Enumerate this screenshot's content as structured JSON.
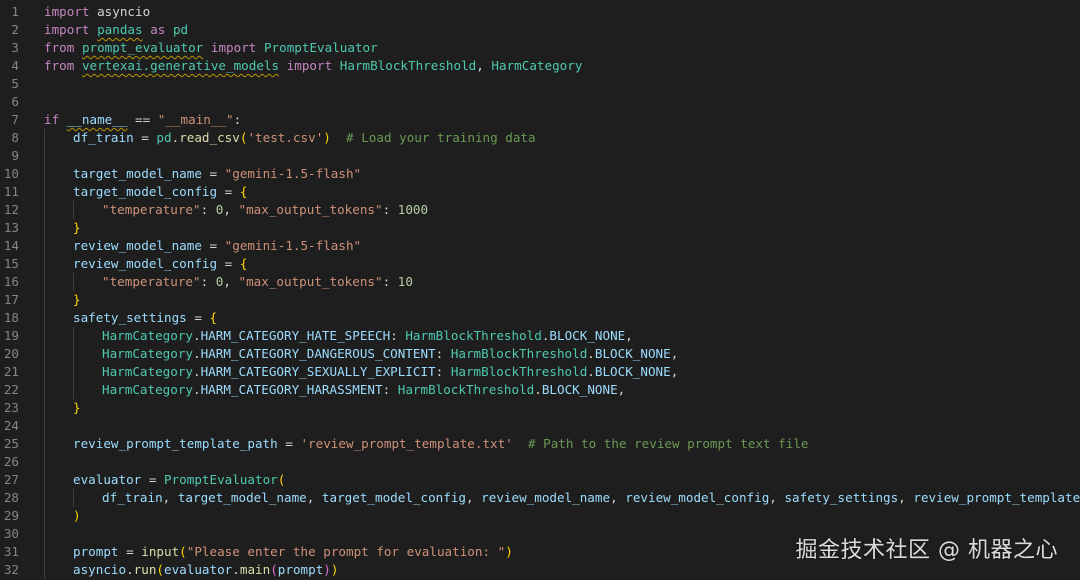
{
  "editor": {
    "language": "python",
    "lines": [
      {
        "n": "1",
        "indent": 0,
        "tokens": [
          [
            "kw",
            "import"
          ],
          [
            "pl",
            " "
          ],
          [
            "pl",
            "asyncio"
          ]
        ]
      },
      {
        "n": "2",
        "indent": 0,
        "tokens": [
          [
            "kw",
            "import"
          ],
          [
            "pl",
            " "
          ],
          [
            "cls sq",
            "pandas"
          ],
          [
            "pl",
            " "
          ],
          [
            "kw",
            "as"
          ],
          [
            "pl",
            " "
          ],
          [
            "cls",
            "pd"
          ]
        ]
      },
      {
        "n": "3",
        "indent": 0,
        "tokens": [
          [
            "kw",
            "from"
          ],
          [
            "pl",
            " "
          ],
          [
            "cls sq",
            "prompt_evaluator"
          ],
          [
            "pl",
            " "
          ],
          [
            "kw",
            "import"
          ],
          [
            "pl",
            " "
          ],
          [
            "cls",
            "PromptEvaluator"
          ]
        ]
      },
      {
        "n": "4",
        "indent": 0,
        "tokens": [
          [
            "kw",
            "from"
          ],
          [
            "pl",
            " "
          ],
          [
            "cls sq",
            "vertexai.generative_models"
          ],
          [
            "pl",
            " "
          ],
          [
            "kw",
            "import"
          ],
          [
            "pl",
            " "
          ],
          [
            "cls",
            "HarmBlockThreshold"
          ],
          [
            "pl",
            ", "
          ],
          [
            "cls",
            "HarmCategory"
          ]
        ]
      },
      {
        "n": "5",
        "indent": 0,
        "tokens": []
      },
      {
        "n": "6",
        "indent": 0,
        "tokens": []
      },
      {
        "n": "7",
        "indent": 0,
        "tokens": [
          [
            "kw",
            "if"
          ],
          [
            "pl",
            " "
          ],
          [
            "var sq",
            "__name__"
          ],
          [
            "pl",
            " == "
          ],
          [
            "str",
            "\"__main__\""
          ],
          [
            "pl",
            ":"
          ]
        ]
      },
      {
        "n": "8",
        "indent": 1,
        "tokens": [
          [
            "var",
            "df_train"
          ],
          [
            "pl",
            " = "
          ],
          [
            "cls",
            "pd"
          ],
          [
            "pl",
            "."
          ],
          [
            "fn",
            "read_csv"
          ],
          [
            "br1",
            "("
          ],
          [
            "str",
            "'test.csv'"
          ],
          [
            "br1",
            ")"
          ],
          [
            "pl",
            "  "
          ],
          [
            "cmt",
            "# Load your training data"
          ]
        ]
      },
      {
        "n": "9",
        "indent": 1,
        "tokens": []
      },
      {
        "n": "10",
        "indent": 1,
        "tokens": [
          [
            "var",
            "target_model_name"
          ],
          [
            "pl",
            " = "
          ],
          [
            "str",
            "\"gemini-1.5-flash\""
          ]
        ]
      },
      {
        "n": "11",
        "indent": 1,
        "tokens": [
          [
            "var",
            "target_model_config"
          ],
          [
            "pl",
            " = "
          ],
          [
            "br1",
            "{"
          ]
        ]
      },
      {
        "n": "12",
        "indent": 2,
        "tokens": [
          [
            "str",
            "\"temperature\""
          ],
          [
            "pl",
            ": "
          ],
          [
            "num",
            "0"
          ],
          [
            "pl",
            ", "
          ],
          [
            "str",
            "\"max_output_tokens\""
          ],
          [
            "pl",
            ": "
          ],
          [
            "num",
            "1000"
          ]
        ]
      },
      {
        "n": "13",
        "indent": 1,
        "tokens": [
          [
            "br1",
            "}"
          ]
        ]
      },
      {
        "n": "14",
        "indent": 1,
        "tokens": [
          [
            "var",
            "review_model_name"
          ],
          [
            "pl",
            " = "
          ],
          [
            "str",
            "\"gemini-1.5-flash\""
          ]
        ]
      },
      {
        "n": "15",
        "indent": 1,
        "tokens": [
          [
            "var",
            "review_model_config"
          ],
          [
            "pl",
            " = "
          ],
          [
            "br1",
            "{"
          ]
        ]
      },
      {
        "n": "16",
        "indent": 2,
        "tokens": [
          [
            "str",
            "\"temperature\""
          ],
          [
            "pl",
            ": "
          ],
          [
            "num",
            "0"
          ],
          [
            "pl",
            ", "
          ],
          [
            "str",
            "\"max_output_tokens\""
          ],
          [
            "pl",
            ": "
          ],
          [
            "num",
            "10"
          ]
        ]
      },
      {
        "n": "17",
        "indent": 1,
        "tokens": [
          [
            "br1",
            "}"
          ]
        ]
      },
      {
        "n": "18",
        "indent": 1,
        "tokens": [
          [
            "var",
            "safety_settings"
          ],
          [
            "pl",
            " = "
          ],
          [
            "br1",
            "{"
          ]
        ]
      },
      {
        "n": "19",
        "indent": 2,
        "tokens": [
          [
            "cls",
            "HarmCategory"
          ],
          [
            "pl",
            "."
          ],
          [
            "var",
            "HARM_CATEGORY_HATE_SPEECH"
          ],
          [
            "pl",
            ": "
          ],
          [
            "cls",
            "HarmBlockThreshold"
          ],
          [
            "pl",
            "."
          ],
          [
            "var",
            "BLOCK_NONE"
          ],
          [
            "pl",
            ","
          ]
        ]
      },
      {
        "n": "20",
        "indent": 2,
        "tokens": [
          [
            "cls",
            "HarmCategory"
          ],
          [
            "pl",
            "."
          ],
          [
            "var",
            "HARM_CATEGORY_DANGEROUS_CONTENT"
          ],
          [
            "pl",
            ": "
          ],
          [
            "cls",
            "HarmBlockThreshold"
          ],
          [
            "pl",
            "."
          ],
          [
            "var",
            "BLOCK_NONE"
          ],
          [
            "pl",
            ","
          ]
        ]
      },
      {
        "n": "21",
        "indent": 2,
        "tokens": [
          [
            "cls",
            "HarmCategory"
          ],
          [
            "pl",
            "."
          ],
          [
            "var",
            "HARM_CATEGORY_SEXUALLY_EXPLICIT"
          ],
          [
            "pl",
            ": "
          ],
          [
            "cls",
            "HarmBlockThreshold"
          ],
          [
            "pl",
            "."
          ],
          [
            "var",
            "BLOCK_NONE"
          ],
          [
            "pl",
            ","
          ]
        ]
      },
      {
        "n": "22",
        "indent": 2,
        "tokens": [
          [
            "cls",
            "HarmCategory"
          ],
          [
            "pl",
            "."
          ],
          [
            "var",
            "HARM_CATEGORY_HARASSMENT"
          ],
          [
            "pl",
            ": "
          ],
          [
            "cls",
            "HarmBlockThreshold"
          ],
          [
            "pl",
            "."
          ],
          [
            "var",
            "BLOCK_NONE"
          ],
          [
            "pl",
            ","
          ]
        ]
      },
      {
        "n": "23",
        "indent": 1,
        "tokens": [
          [
            "br1",
            "}"
          ]
        ]
      },
      {
        "n": "24",
        "indent": 1,
        "tokens": []
      },
      {
        "n": "25",
        "indent": 1,
        "tokens": [
          [
            "var",
            "review_prompt_template_path"
          ],
          [
            "pl",
            " = "
          ],
          [
            "str",
            "'review_prompt_template.txt'"
          ],
          [
            "pl",
            "  "
          ],
          [
            "cmt",
            "# Path to the review prompt text file"
          ]
        ]
      },
      {
        "n": "26",
        "indent": 1,
        "tokens": []
      },
      {
        "n": "27",
        "indent": 1,
        "tokens": [
          [
            "var",
            "evaluator"
          ],
          [
            "pl",
            " = "
          ],
          [
            "cls",
            "PromptEvaluator"
          ],
          [
            "br1",
            "("
          ]
        ]
      },
      {
        "n": "28",
        "indent": 2,
        "tokens": [
          [
            "var",
            "df_train"
          ],
          [
            "pl",
            ", "
          ],
          [
            "var",
            "target_model_name"
          ],
          [
            "pl",
            ", "
          ],
          [
            "var",
            "target_model_config"
          ],
          [
            "pl",
            ", "
          ],
          [
            "var",
            "review_model_name"
          ],
          [
            "pl",
            ", "
          ],
          [
            "var",
            "review_model_config"
          ],
          [
            "pl",
            ", "
          ],
          [
            "var",
            "safety_settings"
          ],
          [
            "pl",
            ", "
          ],
          [
            "var",
            "review_prompt_template_path"
          ]
        ]
      },
      {
        "n": "29",
        "indent": 1,
        "tokens": [
          [
            "br1",
            ")"
          ]
        ]
      },
      {
        "n": "30",
        "indent": 1,
        "tokens": []
      },
      {
        "n": "31",
        "indent": 1,
        "tokens": [
          [
            "var",
            "prompt"
          ],
          [
            "pl",
            " = "
          ],
          [
            "fn",
            "input"
          ],
          [
            "br1",
            "("
          ],
          [
            "str",
            "\"Please enter the prompt for evaluation: \""
          ],
          [
            "br1",
            ")"
          ]
        ]
      },
      {
        "n": "32",
        "indent": 1,
        "tokens": [
          [
            "var",
            "asyncio"
          ],
          [
            "pl",
            "."
          ],
          [
            "fn",
            "run"
          ],
          [
            "br1",
            "("
          ],
          [
            "var",
            "evaluator"
          ],
          [
            "pl",
            "."
          ],
          [
            "fn",
            "main"
          ],
          [
            "br2",
            "("
          ],
          [
            "var",
            "prompt"
          ],
          [
            "br2",
            ")"
          ],
          [
            "br1",
            ")"
          ]
        ]
      }
    ]
  },
  "watermark": "掘金技术社区 @ 机器之心"
}
